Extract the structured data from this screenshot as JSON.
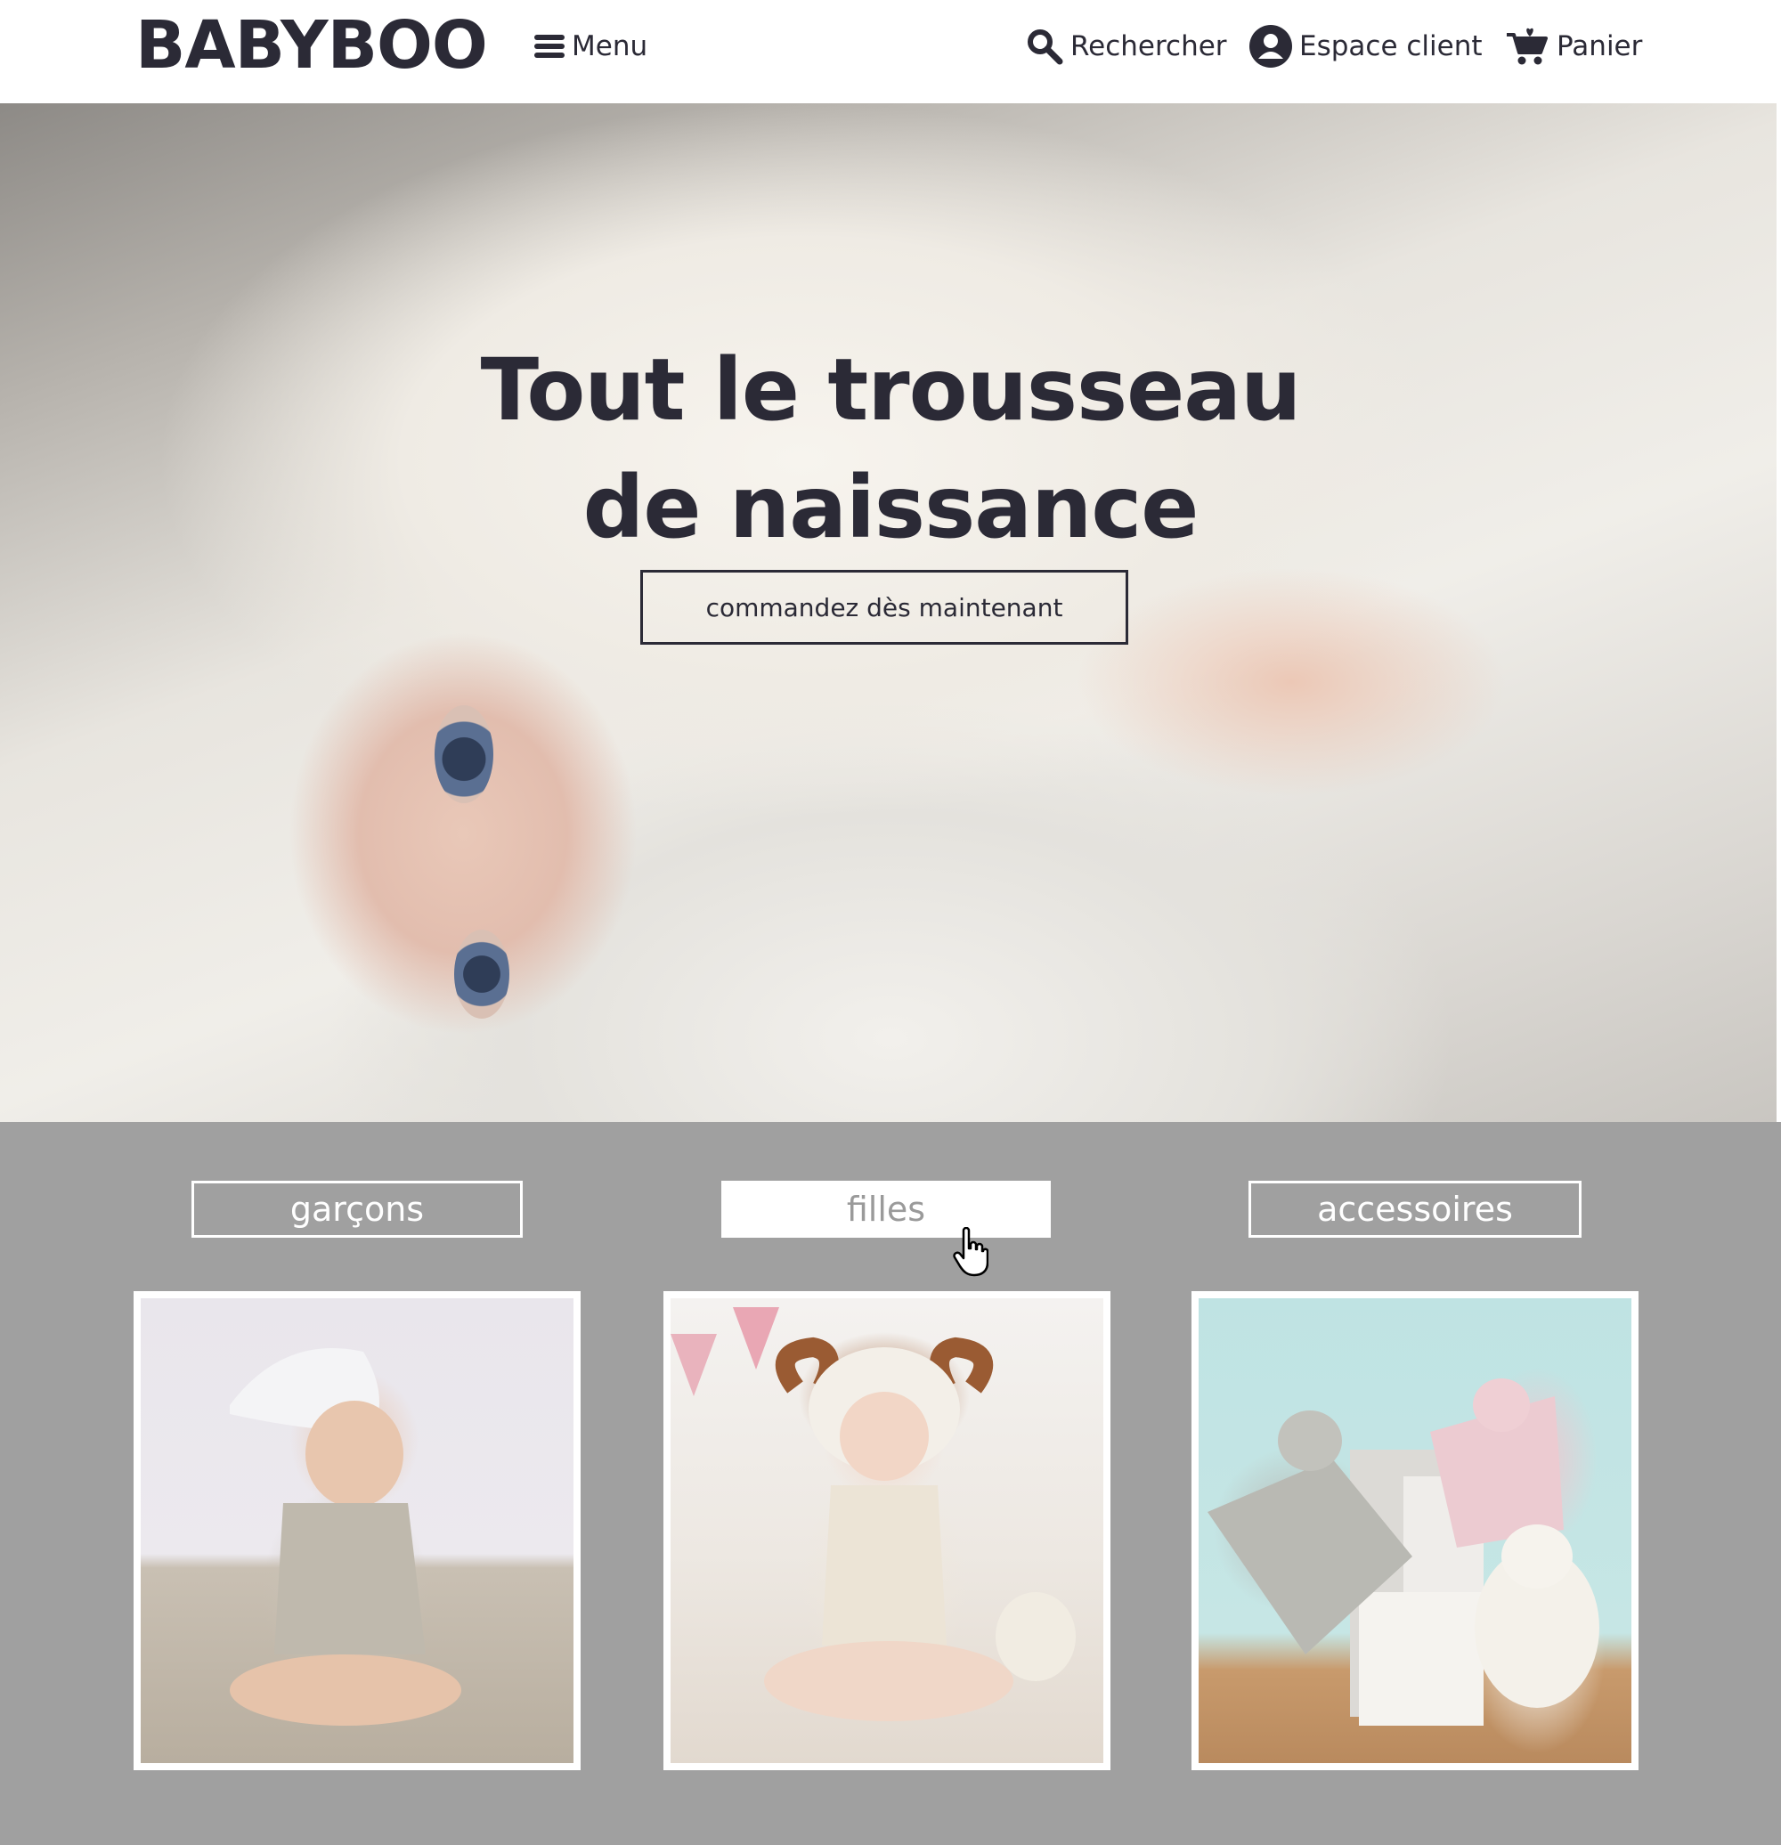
{
  "header": {
    "logo": "BABYBOO",
    "menu_label": "Menu",
    "search_label": "Rechercher",
    "account_label": "Espace client",
    "cart_label": "Panier"
  },
  "hero": {
    "title_line1": "Tout le trousseau",
    "title_line2": "de naissance",
    "cta_label": "commandez dès maintenant"
  },
  "categories": {
    "tabs": [
      {
        "label": "garçons",
        "active": false
      },
      {
        "label": "filles",
        "active": true
      },
      {
        "label": "accessoires",
        "active": false
      }
    ]
  },
  "colors": {
    "text_dark": "#2b2a36",
    "category_bg": "#a0a0a0",
    "active_tab_text": "#9a9a9a",
    "white": "#ffffff"
  },
  "icons": [
    "bars-icon",
    "search-icon",
    "user-circle-icon",
    "cart-icon",
    "hand-cursor-icon"
  ]
}
